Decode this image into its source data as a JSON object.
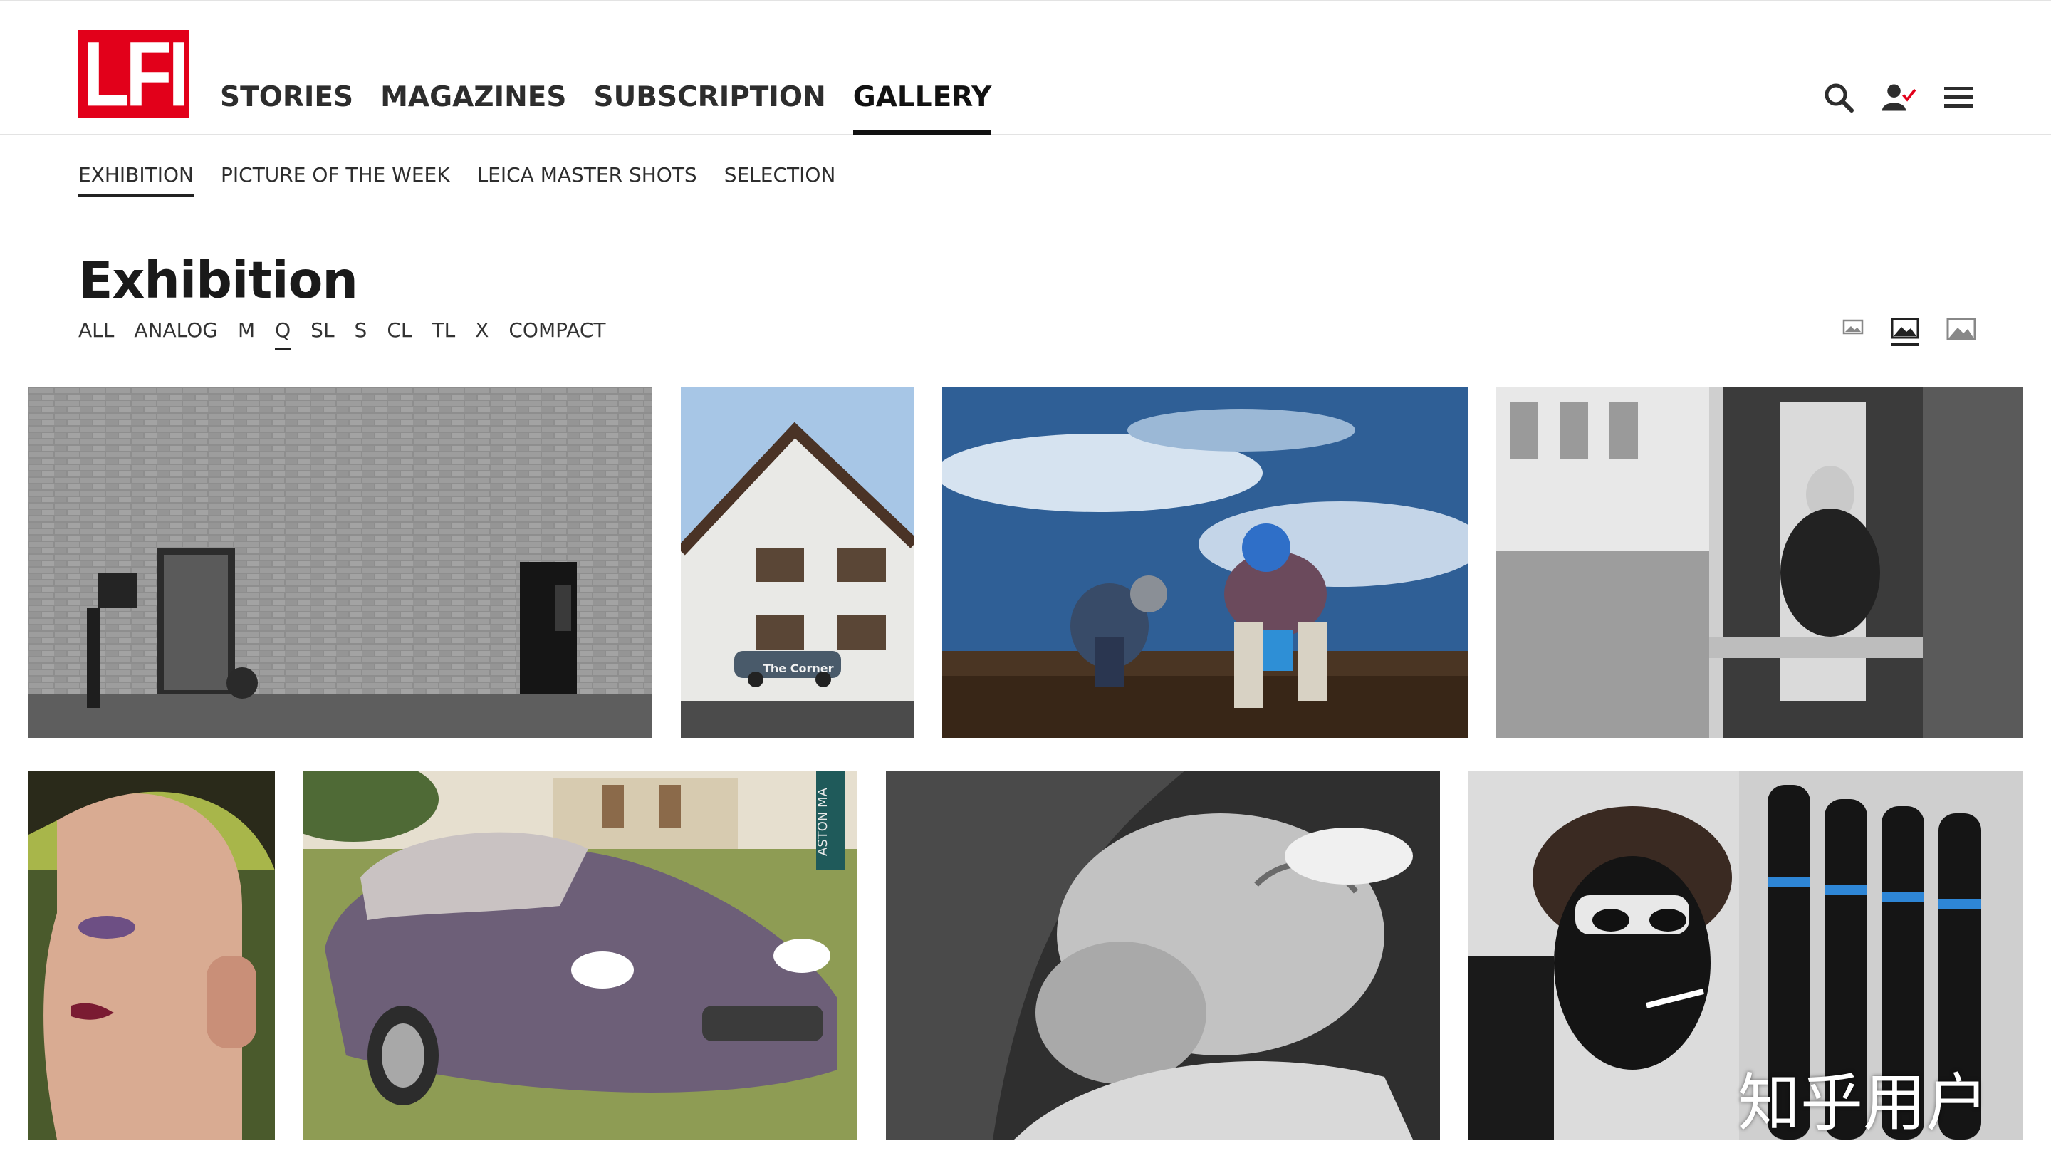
{
  "brand": {
    "logo_text": "LFI",
    "accent": "#e2001a"
  },
  "main_nav": [
    {
      "label": "STORIES",
      "active": false
    },
    {
      "label": "MAGAZINES",
      "active": false
    },
    {
      "label": "SUBSCRIPTION",
      "active": false
    },
    {
      "label": "GALLERY",
      "active": true
    }
  ],
  "header_icons": [
    "search-icon",
    "user-check-icon",
    "menu-icon"
  ],
  "sub_nav": [
    {
      "label": "EXHIBITION",
      "active": true
    },
    {
      "label": "PICTURE OF THE WEEK",
      "active": false
    },
    {
      "label": "LEICA MASTER SHOTS",
      "active": false
    },
    {
      "label": "SELECTION",
      "active": false
    }
  ],
  "page": {
    "title": "Exhibition"
  },
  "filters": [
    {
      "label": "ALL",
      "active": false
    },
    {
      "label": "ANALOG",
      "active": false
    },
    {
      "label": "M",
      "active": false
    },
    {
      "label": "Q",
      "active": true
    },
    {
      "label": "SL",
      "active": false
    },
    {
      "label": "S",
      "active": false
    },
    {
      "label": "CL",
      "active": false
    },
    {
      "label": "TL",
      "active": false
    },
    {
      "label": "X",
      "active": false
    },
    {
      "label": "COMPACT",
      "active": false
    }
  ],
  "view_toggles": [
    {
      "icon": "small-image-icon",
      "active": false
    },
    {
      "icon": "medium-image-icon",
      "active": true
    },
    {
      "icon": "large-image-icon",
      "active": false
    }
  ],
  "photos": [
    {
      "subject": "brick-wall-doorways",
      "caption_in_image": ""
    },
    {
      "subject": "white-house-car",
      "caption_in_image": "The Corner"
    },
    {
      "subject": "field-workers-sky",
      "caption_in_image": ""
    },
    {
      "subject": "cafe-window-man",
      "caption_in_image": ""
    },
    {
      "subject": "portrait-profile-makeup",
      "caption_in_image": ""
    },
    {
      "subject": "purple-classic-car",
      "caption_in_image": "ASTON MA"
    },
    {
      "subject": "sleeping-man",
      "caption_in_image": ""
    },
    {
      "subject": "painted-face-gloves",
      "caption_in_image": ""
    }
  ],
  "watermark": "知乎用户"
}
